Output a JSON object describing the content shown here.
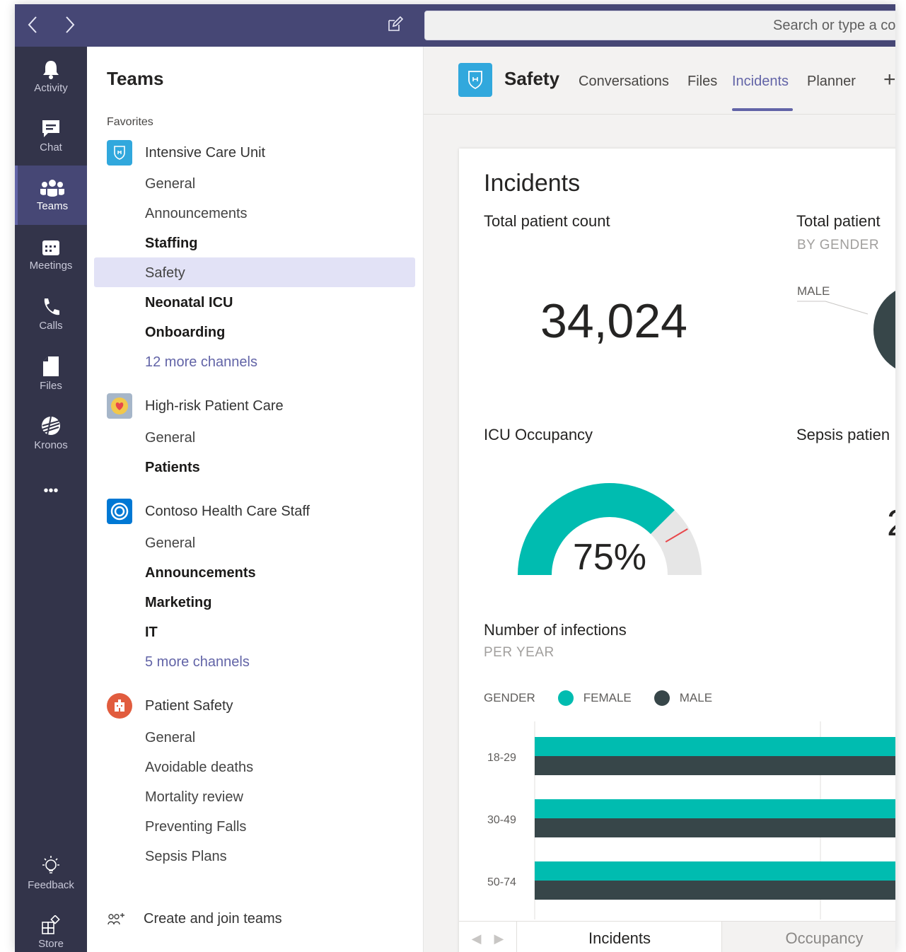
{
  "search": {
    "placeholder": "Search or type a co"
  },
  "appbar": {
    "items": [
      {
        "label": "Activity",
        "icon": "bell-icon"
      },
      {
        "label": "Chat",
        "icon": "chat-icon"
      },
      {
        "label": "Teams",
        "icon": "teams-icon"
      },
      {
        "label": "Meetings",
        "icon": "calendar-icon"
      },
      {
        "label": "Calls",
        "icon": "phone-icon"
      },
      {
        "label": "Files",
        "icon": "file-icon"
      },
      {
        "label": "Kronos",
        "icon": "kronos-icon"
      }
    ],
    "more": "•••",
    "feedback": "Feedback",
    "store": "Store"
  },
  "teams_panel": {
    "title": "Teams",
    "favorites_label": "Favorites",
    "teams": [
      {
        "name": "Intensive Care Unit",
        "channels": [
          "General",
          "Announcements",
          "Staffing",
          "Safety",
          "Neonatal ICU",
          "Onboarding"
        ],
        "more": "12 more channels"
      },
      {
        "name": "High-risk Patient Care",
        "channels": [
          "General",
          "Patients"
        ]
      },
      {
        "name": "Contoso Health Care Staff",
        "channels": [
          "General",
          "Announcements",
          "Marketing",
          "IT"
        ],
        "more": "5 more channels"
      },
      {
        "name": "Patient Safety",
        "channels": [
          "General",
          "Avoidable deaths",
          "Mortality review",
          "Preventing Falls",
          "Sepsis Plans"
        ]
      }
    ],
    "create": "Create and join teams"
  },
  "header": {
    "channel": "Safety",
    "tabs": [
      "Conversations",
      "Files",
      "Incidents",
      "Planner"
    ],
    "active_tab": "Incidents",
    "plus": "+"
  },
  "dashboard": {
    "title": "Incidents",
    "total_count": {
      "title": "Total patient count",
      "value": "34,024"
    },
    "by_gender": {
      "title": "Total patient",
      "subtitle": "BY GENDER",
      "label": "MALE"
    },
    "icu": {
      "title": "ICU Occupancy",
      "value": "75%"
    },
    "sepsis": {
      "title": "Sepsis patien",
      "value_partial": "2"
    },
    "infections": {
      "title": "Number of infections",
      "subtitle": "PER YEAR",
      "legend_title": "GENDER"
    },
    "bottom_tabs": [
      "Incidents",
      "Occupancy"
    ]
  },
  "colors": {
    "accent": "#6264a7",
    "teal": "#00bcb0",
    "dark": "#374649",
    "gauge_empty": "#e6e6e6",
    "gauge_mark": "#e8474b"
  },
  "chart_data": [
    {
      "type": "gauge",
      "title": "ICU Occupancy",
      "value": 75,
      "max": 100,
      "label": "75%"
    },
    {
      "type": "bar",
      "title": "Number of infections",
      "subtitle": "PER YEAR",
      "categories": [
        "18-29",
        "30-49",
        "50-74"
      ],
      "series": [
        {
          "name": "FEMALE",
          "color": "#00bcb0"
        },
        {
          "name": "MALE",
          "color": "#374649"
        }
      ]
    }
  ]
}
